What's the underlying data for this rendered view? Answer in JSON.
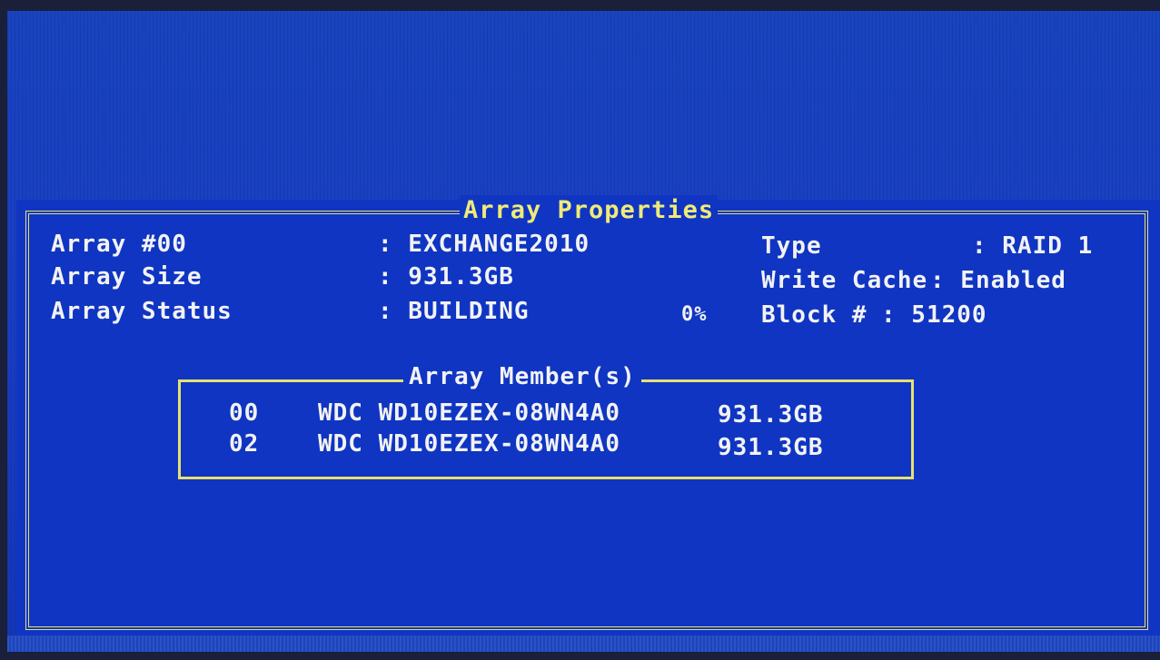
{
  "window": {
    "title": "Array Properties"
  },
  "properties": {
    "array_label": "Array #00",
    "array_value": ": EXCHANGE2010",
    "size_label": "Array Size",
    "size_value": ": 931.3GB",
    "status_label": "Array Status",
    "status_value": ": BUILDING",
    "progress": "0%",
    "progress_fraction": 0,
    "type_label": "Type",
    "type_value": ": RAID 1",
    "cache_label": "Write Cache",
    "cache_value": ": Enabled",
    "block_label": "Block #",
    "block_value": ": 51200"
  },
  "members": {
    "title": "Array Member(s)",
    "rows": [
      {
        "id": "00",
        "model": "WDC WD10EZEX-08WN4A0",
        "size": "931.3GB"
      },
      {
        "id": "02",
        "model": "WDC WD10EZEX-08WN4A0",
        "size": "931.3GB"
      }
    ]
  },
  "colors": {
    "background": "#0f35c2",
    "border": "#e8e070",
    "title_text": "#f0ea78",
    "text": "#f2f2f2"
  }
}
